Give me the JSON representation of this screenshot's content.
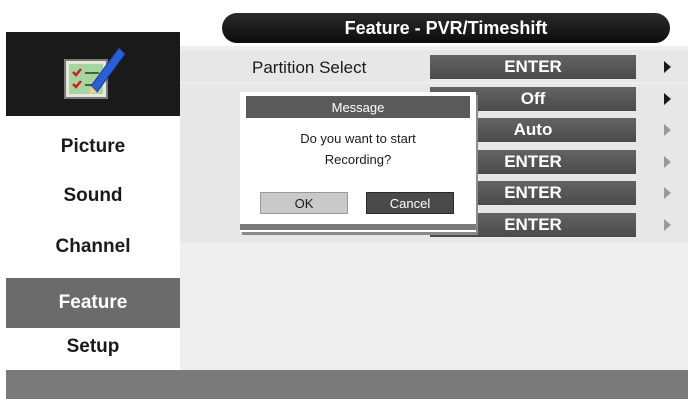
{
  "header": {
    "title": "Feature - PVR/Timeshift"
  },
  "sidebar": {
    "icon": "checklist-pencil-icon",
    "items": [
      {
        "label": "Picture",
        "active": false
      },
      {
        "label": "Sound",
        "active": false
      },
      {
        "label": "Channel",
        "active": false
      },
      {
        "label": "Feature",
        "active": true
      },
      {
        "label": "Setup",
        "active": false
      }
    ]
  },
  "settings": {
    "rows": [
      {
        "label": "Partition Select",
        "value": "ENTER"
      },
      {
        "label": "",
        "value": "Off"
      },
      {
        "label": "",
        "value": "Auto"
      },
      {
        "label": "",
        "value": "ENTER"
      },
      {
        "label": "",
        "value": "ENTER"
      },
      {
        "label": "",
        "value": "ENTER"
      }
    ]
  },
  "dialog": {
    "title": "Message",
    "line1": "Do you want to start",
    "line2": "Recording?",
    "ok_label": "OK",
    "cancel_label": "Cancel"
  },
  "colors": {
    "title_bar": "#111111",
    "active_item": "#6b6b6b",
    "value_box": "#555555"
  }
}
